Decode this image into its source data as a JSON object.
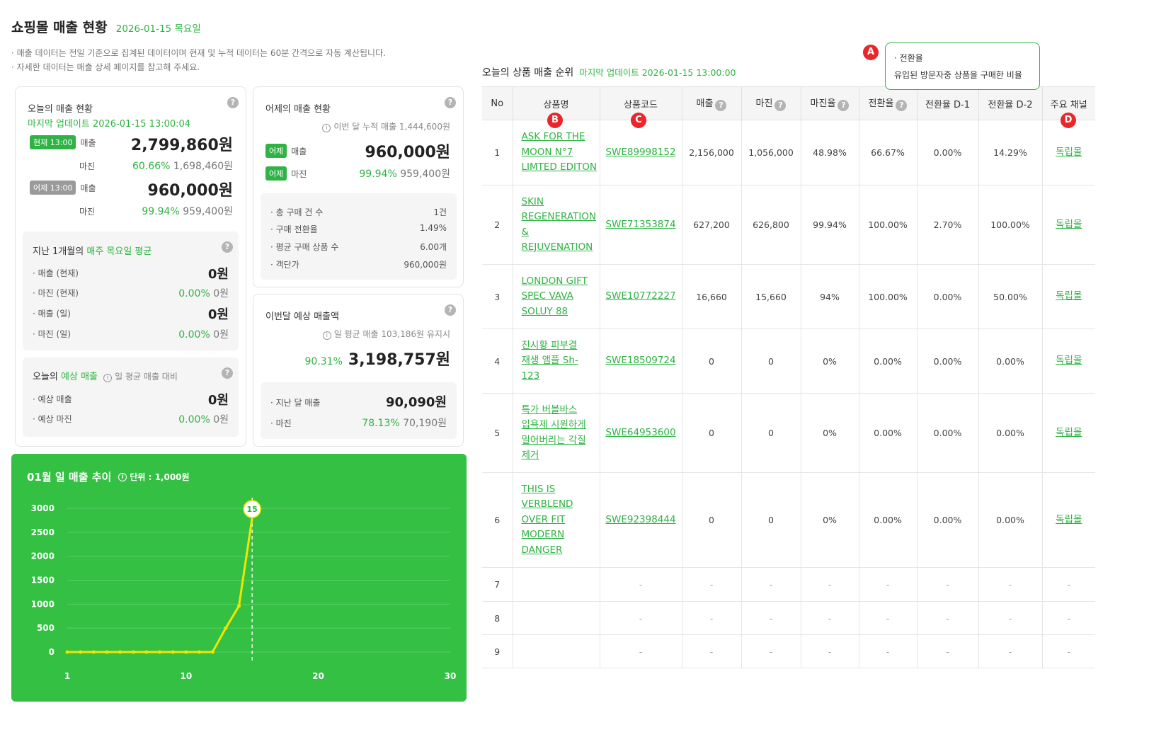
{
  "header": {
    "title": "쇼핑몰 매출 현황",
    "date": "2026-01-15 목요일",
    "notes": [
      "· 매출 데이터는 전일 기준으로 집계된 데이터이며 현재 및 누적 데이터는 60분 간격으로 자동 계산됩니다.",
      "· 자세한 데이터는 매출 상세 페이지를 참고해 주세요."
    ]
  },
  "today_card": {
    "title": "오늘의 매출 현황",
    "updated": "마지막 업데이트 2026-01-15 13:00:04",
    "now_badge": "현재 13:00",
    "yday_badge": "어제 13:00",
    "sales_label": "매출",
    "margin_label": "마진",
    "now_sales": "2,799,860원",
    "now_margin_rate": "60.66%",
    "now_margin": "1,698,460원",
    "yday_sales": "960,000원",
    "yday_margin_rate": "99.94%",
    "yday_margin": "959,400원"
  },
  "avg_card": {
    "title_pre": "지난 1개월의",
    "title_hl": "매주 목요일 평균",
    "rows": [
      {
        "label": "· 매출 (현재)",
        "rate": "",
        "value": "0원"
      },
      {
        "label": "· 마진 (현재)",
        "rate": "0.00%",
        "value": "0원"
      },
      {
        "label": "· 매출 (일)",
        "rate": "",
        "value": "0원"
      },
      {
        "label": "· 마진 (일)",
        "rate": "0.00%",
        "value": "0원"
      }
    ]
  },
  "expect_card": {
    "title_pre": "오늘의",
    "title_hl": "예상 매출",
    "hint": "일 평균 매출 대비",
    "rows": [
      {
        "label": "· 예상 매출",
        "rate": "",
        "value": "0원"
      },
      {
        "label": "· 예상 마진",
        "rate": "0.00%",
        "value": "0원"
      }
    ]
  },
  "yday_card": {
    "title": "어제의 매출 현황",
    "hint": "이번 달 누적 매출 1,444,600원",
    "badge": "어제",
    "sales_label": "매출",
    "margin_label": "마진",
    "sales": "960,000원",
    "margin_rate": "99.94%",
    "margin": "959,400원",
    "stats": [
      {
        "label": "· 총 구매 건 수",
        "value": "1건"
      },
      {
        "label": "· 구매 전환율",
        "value": "1.49%"
      },
      {
        "label": "· 평균 구매 상품 수",
        "value": "6.00개"
      },
      {
        "label": "· 객단가",
        "value": "960,000원"
      }
    ]
  },
  "month_card": {
    "title": "이번달 예상 매출액",
    "hint": "일 평균 매출 103,186원 유지시",
    "rate": "90.31%",
    "value": "3,198,757원",
    "last_label": "· 지난 달 매출",
    "last_value": "90,090원",
    "margin_label": "· 마진",
    "margin_rate": "78.13%",
    "margin_value": "70,190원"
  },
  "chart_panel": {
    "title": "01월 일 매출 추이",
    "unit": "단위 : 1,000원",
    "marker_label": "15"
  },
  "chart_data": {
    "type": "line",
    "title": "01월 일 매출 추이",
    "unit": "단위 : 1,000원",
    "x": [
      1,
      2,
      3,
      4,
      5,
      6,
      7,
      8,
      9,
      10,
      11,
      12,
      13,
      14,
      15
    ],
    "values": [
      0,
      0,
      0,
      0,
      0,
      0,
      0,
      0,
      0,
      0,
      0,
      0,
      500,
      960,
      2800
    ],
    "xticks": [
      1,
      10,
      20,
      30
    ],
    "yticks": [
      0,
      500,
      1000,
      1500,
      2000,
      2500,
      3000
    ],
    "xlim": [
      1,
      30
    ],
    "ylim": [
      0,
      3000
    ],
    "highlight_x": 15,
    "grid": true,
    "colors": {
      "line": "#f2e600",
      "panel": "#33c043",
      "grid": "#5ad265"
    }
  },
  "rank": {
    "title": "오늘의 상품 매출 순위",
    "updated": "마지막 업데이트 2026-01-15 13:00:00",
    "headers": [
      "No",
      "상품명",
      "상품코드",
      "매출",
      "마진",
      "마진율",
      "전환율",
      "전환율 D-1",
      "전환율 D-2",
      "주요 채널"
    ],
    "rows": [
      {
        "no": "1",
        "name": [
          "ASK FOR THE",
          "MOON N°7",
          "LIMTED EDITON"
        ],
        "code": "SWE89998152",
        "sales": "2,156,000",
        "margin": "1,056,000",
        "mrate": "48.98%",
        "conv": "66.67%",
        "d1": "0.00%",
        "d2": "14.29%",
        "channel": "독립몰"
      },
      {
        "no": "2",
        "name": [
          "SKIN",
          "REGENERATION",
          "&",
          "REJUVENATION"
        ],
        "code": "SWE71353874",
        "sales": "627,200",
        "margin": "626,800",
        "mrate": "99.94%",
        "conv": "100.00%",
        "d1": "2.70%",
        "d2": "100.00%",
        "channel": "독립몰"
      },
      {
        "no": "3",
        "name": [
          "LONDON GIFT",
          "SPEC VAVA",
          "SOLUY 88"
        ],
        "code": "SWE10772227",
        "sales": "16,660",
        "margin": "15,660",
        "mrate": "94%",
        "conv": "100.00%",
        "d1": "0.00%",
        "d2": "50.00%",
        "channel": "독립몰"
      },
      {
        "no": "4",
        "name": [
          "진시황 피부결",
          "재생 앰플 Sh-",
          "123"
        ],
        "code": "SWE18509724",
        "sales": "0",
        "margin": "0",
        "mrate": "0%",
        "conv": "0.00%",
        "d1": "0.00%",
        "d2": "0.00%",
        "channel": "독립몰"
      },
      {
        "no": "5",
        "name": [
          "특가 버블바스",
          "입욕제 시원하게",
          "밀어버리는 각질",
          "제거"
        ],
        "code": "SWE64953600",
        "sales": "0",
        "margin": "0",
        "mrate": "0%",
        "conv": "0.00%",
        "d1": "0.00%",
        "d2": "0.00%",
        "channel": "독립몰"
      },
      {
        "no": "6",
        "name": [
          "THIS IS",
          "VERBLEND",
          "OVER FIT",
          "MODERN",
          "DANGER"
        ],
        "code": "SWE92398444",
        "sales": "0",
        "margin": "0",
        "mrate": "0%",
        "conv": "0.00%",
        "d1": "0.00%",
        "d2": "0.00%",
        "channel": "독립몰"
      },
      {
        "no": "7",
        "name": [],
        "code": "-",
        "sales": "-",
        "margin": "-",
        "mrate": "-",
        "conv": "-",
        "d1": "-",
        "d2": "-",
        "channel": "-"
      },
      {
        "no": "8",
        "name": [],
        "code": "-",
        "sales": "-",
        "margin": "-",
        "mrate": "-",
        "conv": "-",
        "d1": "-",
        "d2": "-",
        "channel": "-"
      },
      {
        "no": "9",
        "name": [],
        "code": "-",
        "sales": "-",
        "margin": "-",
        "mrate": "-",
        "conv": "-",
        "d1": "-",
        "d2": "-",
        "channel": "-"
      }
    ]
  },
  "tooltip": {
    "title": "· 전환율",
    "body": "유입된 방문자중 상품을 구매한 비율"
  },
  "markers": {
    "a": "A",
    "b": "B",
    "c": "C",
    "d": "D"
  },
  "help_glyph": "?",
  "info_glyph": "i"
}
